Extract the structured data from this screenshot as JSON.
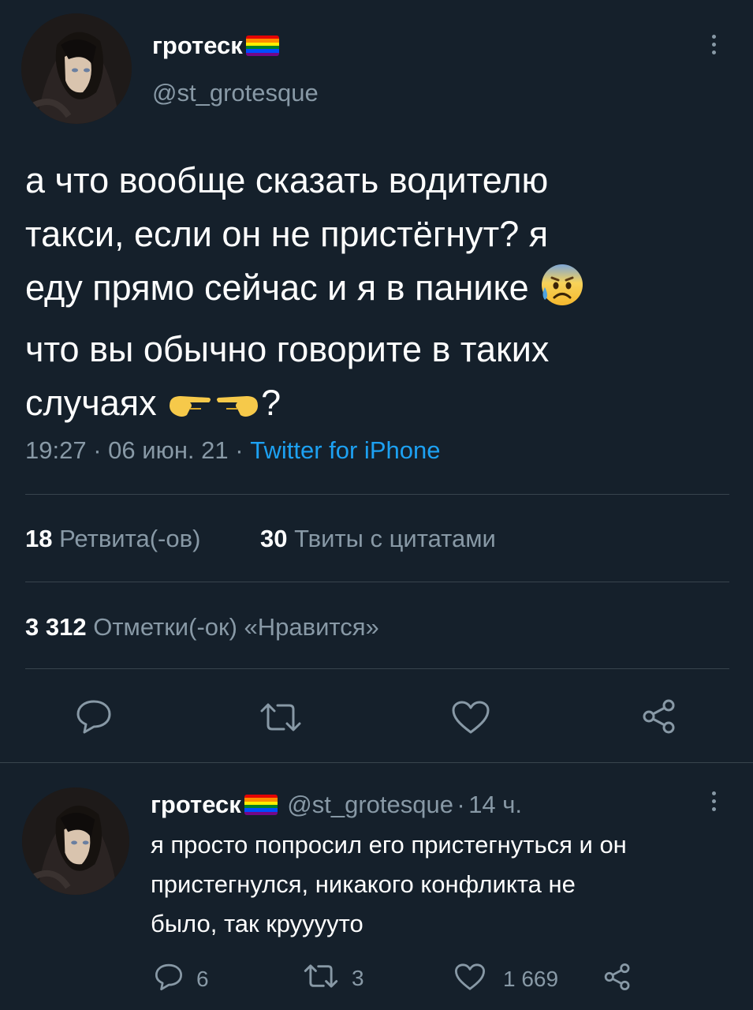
{
  "main_tweet": {
    "author_name": "гротеск",
    "author_handle": "@st_grotesque",
    "text_lines": [
      "а что вообще сказать водителю",
      "такси, если он не пристёгнут? я",
      "еду прямо сейчас и я в панике",
      "что вы обычно говорите в таких",
      "случаях"
    ],
    "text_end": "?",
    "time": "19:27",
    "date": "06 июн. 21",
    "source": "Twitter for iPhone",
    "retweets_count": "18",
    "retweets_label": "Ретвита(-ов)",
    "quotes_count": "30",
    "quotes_label": "Твиты с цитатами",
    "likes_count": "3 312",
    "likes_label": "Отметки(-ок) «Нравится»"
  },
  "reply_tweet": {
    "author_name": "гротеск",
    "author_handle": "@st_grotesque",
    "time_ago": "14 ч.",
    "text_lines": [
      "я просто попросил его пристегнуться и он",
      "пристегнулся, никакого конфликта не",
      "было, так крууууто"
    ],
    "reply_count": "6",
    "retweet_count": "3",
    "like_count": "1 669"
  },
  "icons": {
    "reply": "reply-icon",
    "retweet": "retweet-icon",
    "like": "heart-icon",
    "share": "share-icon",
    "more": "more-vertical-icon"
  },
  "colors": {
    "background": "#15202b",
    "secondary_text": "#8899a6",
    "link": "#1da1f2",
    "divider": "#38444d"
  }
}
